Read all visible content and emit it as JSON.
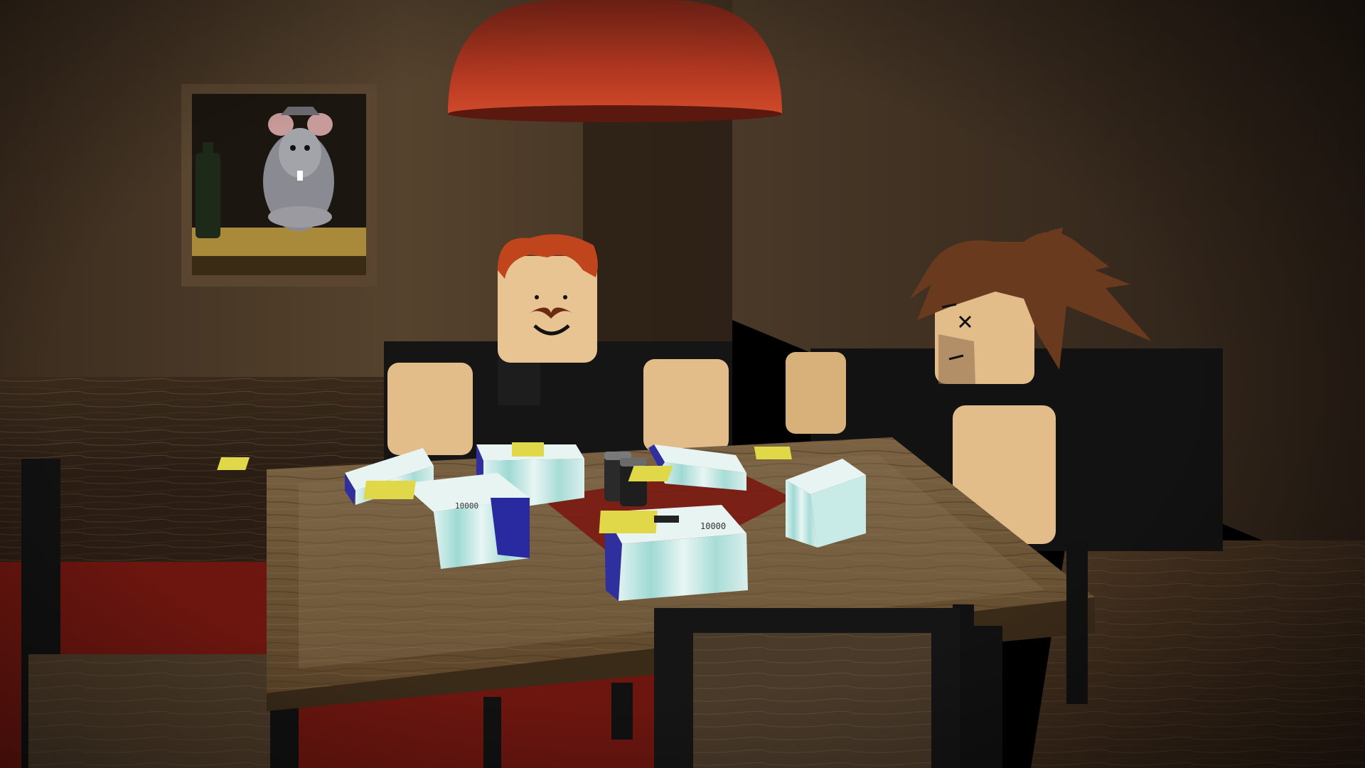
{
  "scene": {
    "title": "",
    "money_label": "10000"
  },
  "palette": {
    "wall_left": "#4a3826",
    "wall_right": "#3a2c1f",
    "lamp_red": "#b83a22",
    "table_wood": "#6e5535",
    "rug_red": "#7a1a12",
    "skin": "#e8c493",
    "hair_red": "#c0451c",
    "hair_brown": "#6a3a1e",
    "shirt": "#151515",
    "cash_face": "#e6f5f3",
    "cash_band": "#2f2f9e"
  }
}
